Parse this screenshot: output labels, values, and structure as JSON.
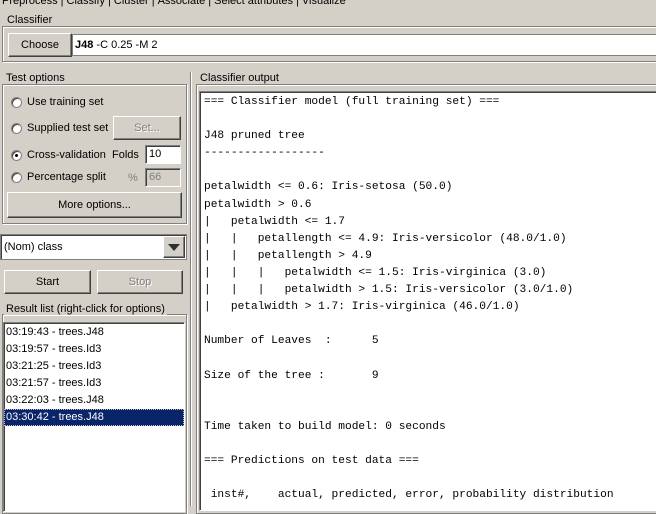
{
  "tabs": [
    {
      "label": "Preprocess",
      "active": false
    },
    {
      "label": "Classify",
      "active": true
    },
    {
      "label": "Cluster",
      "active": false
    },
    {
      "label": "Associate",
      "active": false
    },
    {
      "label": "Select attributes",
      "active": false
    },
    {
      "label": "Visualize",
      "active": false
    }
  ],
  "classifier": {
    "group_label": "Classifier",
    "choose_label": "Choose",
    "name": "J48",
    "options": " -C 0.25 -M 2"
  },
  "test_options": {
    "group_label": "Test options",
    "use_training": "Use training set",
    "supplied_test": "Supplied test set",
    "set_label": "Set...",
    "cross_validation": "Cross-validation",
    "folds_label": "Folds",
    "folds_value": "10",
    "percentage_split": "Percentage split",
    "percent_sign": "%",
    "percent_value": "66",
    "more_options": "More options...",
    "selected": "cross_validation"
  },
  "class_select": {
    "value": "(Nom) class"
  },
  "actions": {
    "start": "Start",
    "stop": "Stop"
  },
  "result_list": {
    "group_label": "Result list (right-click for options)",
    "items": [
      "03:19:43 - trees.J48",
      "03:19:57 - trees.Id3",
      "03:21:25 - trees.Id3",
      "03:21:57 - trees.Id3",
      "03:22:03 - trees.J48",
      "03:30:42 - trees.J48"
    ],
    "selected_index": 5
  },
  "output": {
    "group_label": "Classifier output",
    "lines": [
      "=== Classifier model (full training set) ===",
      "",
      "J48 pruned tree",
      "------------------",
      "",
      "petalwidth <= 0.6: Iris-setosa (50.0)",
      "petalwidth > 0.6",
      "|   petalwidth <= 1.7",
      "|   |   petallength <= 4.9: Iris-versicolor (48.0/1.0)",
      "|   |   petallength > 4.9",
      "|   |   |   petalwidth <= 1.5: Iris-virginica (3.0)",
      "|   |   |   petalwidth > 1.5: Iris-versicolor (3.0/1.0)",
      "|   petalwidth > 1.7: Iris-virginica (46.0/1.0)",
      "",
      "Number of Leaves  :      5",
      "",
      "Size of the tree :       9",
      "",
      "",
      "Time taken to build model: 0 seconds",
      "",
      "=== Predictions on test data ===",
      "",
      " inst#,    actual, predicted, error, probability distribution"
    ]
  }
}
